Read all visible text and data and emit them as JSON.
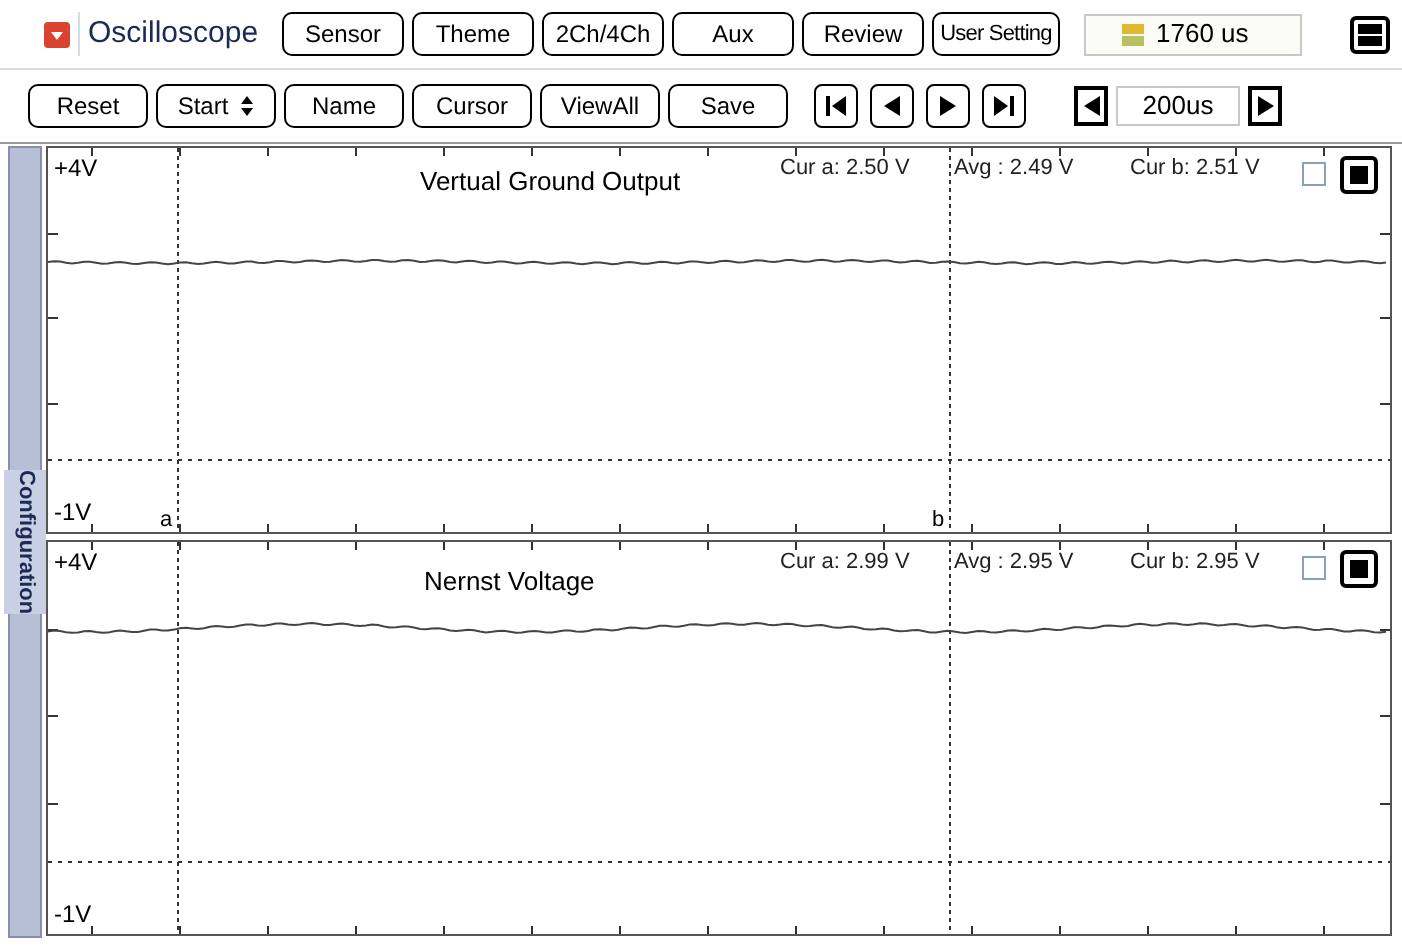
{
  "title": "Oscilloscope",
  "tabs": [
    "Sensor",
    "Theme",
    "2Ch/4Ch",
    "Aux",
    "Review",
    "User Setting"
  ],
  "time_display": "1760 us",
  "toolbar": [
    {
      "label": "Reset",
      "kind": "plain"
    },
    {
      "label": "Start",
      "kind": "spinner"
    },
    {
      "label": "Name",
      "kind": "plain"
    },
    {
      "label": "Cursor",
      "kind": "plain"
    },
    {
      "label": "ViewAll",
      "kind": "plain"
    },
    {
      "label": "Save",
      "kind": "plain"
    }
  ],
  "timebase": "200us",
  "side_tab": "Configuration",
  "channels": [
    {
      "title": "Vertual Ground Output",
      "y_max": "+4V",
      "y_min": "-1V",
      "cur_a": "Cur a: 2.50 V",
      "avg": "Avg  : 2.49 V",
      "cur_b": "Cur b: 2.51 V",
      "checked": false,
      "cursor_labels": [
        "a",
        "b"
      ]
    },
    {
      "title": "Nernst Voltage",
      "y_max": "+4V",
      "y_min": "-1V",
      "cur_a": "Cur a: 2.99 V",
      "avg": "Avg  : 2.95 V",
      "cur_b": "Cur b: 2.95 V",
      "checked": false
    }
  ]
}
